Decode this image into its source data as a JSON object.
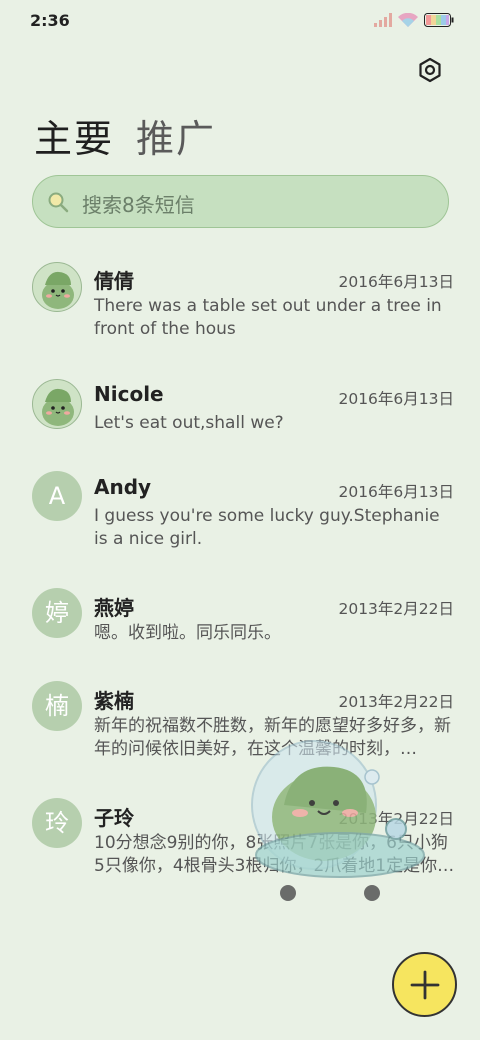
{
  "status": {
    "time": "2:36"
  },
  "tabs": [
    {
      "label": "主要",
      "active": true
    },
    {
      "label": "推广",
      "active": false
    }
  ],
  "search": {
    "placeholder": "搜索8条短信"
  },
  "conversations": [
    {
      "name": "倩倩",
      "date": "2016年6月13日",
      "avatar": "",
      "preview": "There was a table set out under a tree in front of the hous"
    },
    {
      "name": "Nicole",
      "date": "2016年6月13日",
      "avatar": "",
      "preview": "Let's eat out,shall we?"
    },
    {
      "name": "Andy",
      "date": "2016年6月13日",
      "avatar": "A",
      "preview": "I guess you're some lucky guy.Stephanie is a nice girl."
    },
    {
      "name": "燕婷",
      "date": "2013年2月22日",
      "avatar": "婷",
      "preview": "嗯。收到啦。同乐同乐。"
    },
    {
      "name": "紫楠",
      "date": "2013年2月22日",
      "avatar": "楠",
      "preview": "新年的祝福数不胜数，新年的愿望好多好多，新年的问候依旧美好，在这个温馨的时刻，…"
    },
    {
      "name": "子玲",
      "date": "2013年2月22日",
      "avatar": "玲",
      "preview": "10分想念9别的你，8张照片7张是你，6只小狗5只像你，4根骨头3根归你，2爪着地1定是你…"
    }
  ],
  "colors": {
    "background": "#e9f1e5",
    "search_fill": "#c6e0c0",
    "avatar": "#b6cfae",
    "fab": "#f6e55f"
  }
}
